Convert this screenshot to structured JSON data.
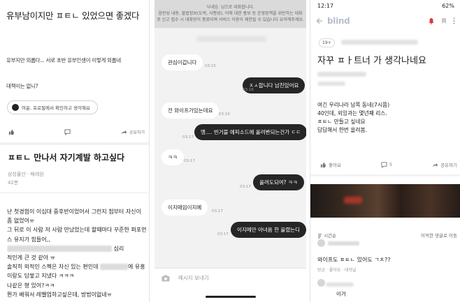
{
  "panel1": {
    "title": "유부남이지만  ㅍㅌㄴ 있었으면 좋겠다",
    "body_line1": "유부지만 외롭다... 서로 초반 유부인생이 이렇게 외롭네",
    "body_line2": "대책이는 없니?",
    "chip_label": "여윤, 프로필에서 확인하고 생각해요",
    "like_label": "",
    "comment_label": "",
    "share_label": "공유하기",
    "post_title": "ㅍㅌㄴ 만나서 자기계발 하고싶다",
    "company": "삼성물산 · 페레원",
    "time_ago": "42분",
    "content_lines": [
      "난 첫경험이 이십대 중후반이었어서 그런지 첨부터 자신이",
      "좀 없었어ㅠ",
      "그 뒤로 이 사람 저 사람 만났었는데 할때마다 꾸준한 퍼포먼",
      "스 유지가 힘들어,,",
      "심리",
      "적인게 큰 것 같아 ㅠ",
      "솔직히 외적인 스펙은 자신 있는 편인데",
      "에 유흥",
      "이랑도 담쌓고 지냈다 ㅋㅋㅋ",
      "나같은 형 있어?ㅋㅋ",
      "뭔가 배워서 레벨업하고싶은데, 방법이없네ㅠ"
    ]
  },
  "panel2": {
    "notice_line1": "닉네임:                 님으로 대화합니다.",
    "notice_line2": "음란성 내용, 불법정보(도박, 사행성), 이에 대한 홍보 등 운영정책을 위반하는 대화",
    "notice_line3": "로 신고 접수 시 대화방이 종료되며 서비스 이용이 제한될 수 있습니다 유의해주세요.",
    "messages": [
      {
        "side": "l",
        "text": "관심이갑니다",
        "time": "03:15"
      },
      {
        "side": "r",
        "text": "ㅈㅅ합니다 남친있어요",
        "time": "03:16"
      },
      {
        "side": "l",
        "text": "전 와이프가있는데요",
        "time": "03:16"
      },
      {
        "side": "r",
        "text": "엥.... 빈거블 에피소드에 올려봔되는건가 ㄷㄷ",
        "time": "03:17"
      },
      {
        "side": "l",
        "text": "ㅋㅋ",
        "time": "03:17"
      },
      {
        "side": "r",
        "text": "올려도되여? ㅋㅋ",
        "time": "03:17"
      },
      {
        "side": "l",
        "text": "이지매임이지예",
        "time": "03:17"
      },
      {
        "side": "r",
        "text": "이지메만 아녀욤 한 울렸는디",
        "time": "03:17"
      }
    ],
    "input_placeholder": "메시지 보내기"
  },
  "panel3": {
    "clock": "12:17",
    "battery": "62%",
    "app_name": "blind",
    "badge": "19+",
    "title": "자꾸 ㅍㅏ트너 가 생각나네요",
    "content_lines": [
      "여긴 우리나라 남쪽 동네(7시쯤)",
      "40인데, 외잉과는 몇년째 리스.",
      "ㅍㅌㄴ 만들고 싶네요",
      "답답해서 한번 올려봄."
    ],
    "like_label": "좋아요",
    "comment_count": "5",
    "share_label": "공유하기",
    "banner_text": "",
    "sort_label": "시간순",
    "sort_right": "이적한 댓글로 이동",
    "comment_author": "",
    "comment_text": "와이프도 ㅍㅌㄴ 있어도 ㄱㅊ??",
    "comment_meta": "방금 · 좋아요 · 대댓글",
    "comment2_text": "이거"
  }
}
